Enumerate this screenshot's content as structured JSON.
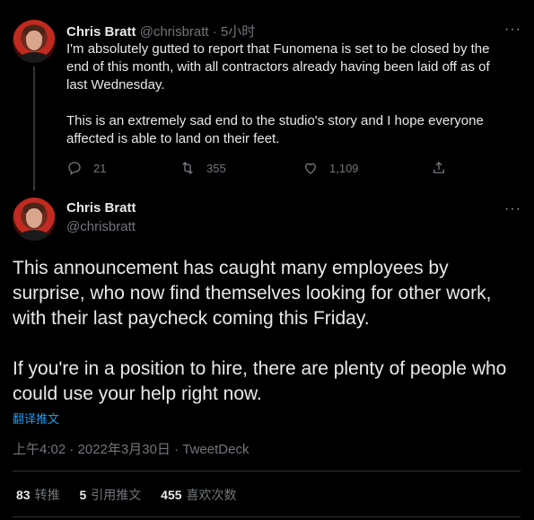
{
  "tweet1": {
    "author_name": "Chris Bratt",
    "handle": "@chrisbratt",
    "time": "5小时",
    "paragraphs": [
      "I'm absolutely gutted to report that Funomena is set to be closed by the end of this month, with all contractors already having been laid off as of last Wednesday.",
      "This is an extremely sad end to the studio's story and I hope everyone affected is able to land on their feet."
    ],
    "replies": "21",
    "retweets": "355",
    "likes": "1,109",
    "icons": {
      "reply": "reply-icon",
      "retweet": "retweet-icon",
      "like": "like-icon",
      "share": "share-icon",
      "more": "more-icon"
    }
  },
  "tweet2": {
    "author_name": "Chris Bratt",
    "handle": "@chrisbratt",
    "paragraphs": [
      "This announcement has caught many employees by surprise, who now find themselves looking for other work, with their last paycheck coming this Friday.",
      "If you're in a position to hire, there are plenty of people who could use your help right now."
    ],
    "translate_label": "翻译推文",
    "meta": "上午4:02 · 2022年3月30日 · TweetDeck",
    "stats": {
      "retweets_count": "83",
      "retweets_label": "转推",
      "quotes_count": "5",
      "quotes_label": "引用推文",
      "likes_count": "455",
      "likes_label": "喜欢次数"
    }
  },
  "colors": {
    "background": "#000000",
    "text": "#e7e9ea",
    "muted": "#71767b",
    "link": "#1d9bf0",
    "divider": "#2f3336"
  }
}
